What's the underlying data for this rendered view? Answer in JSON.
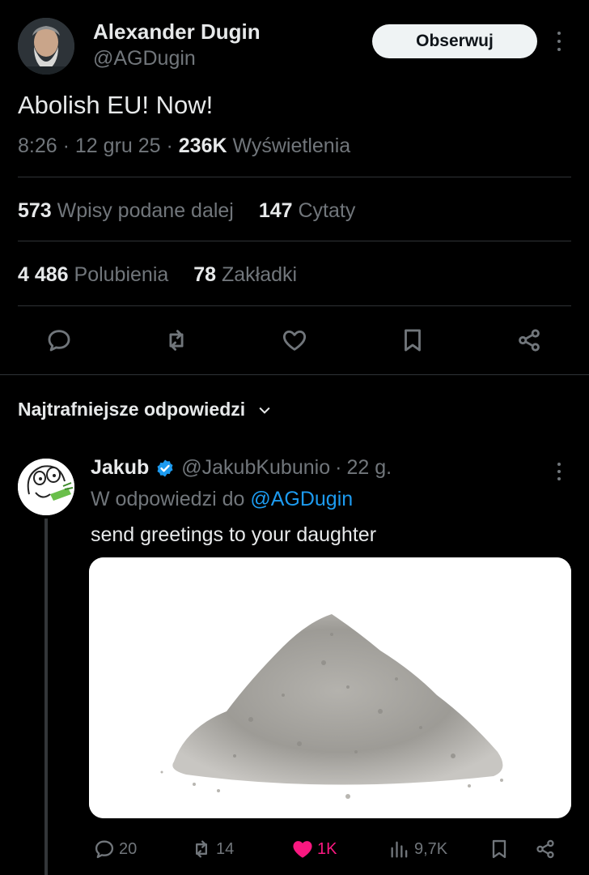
{
  "tweet": {
    "author_name": "Alexander Dugin",
    "author_handle": "@AGDugin",
    "follow_label": "Obserwuj",
    "text": "Abolish EU! Now!",
    "time": "8:26",
    "date": "12 gru 25",
    "views_count": "236K",
    "views_label": "Wyświetlenia",
    "separator": "·"
  },
  "stats": {
    "reposts_count": "573",
    "reposts_label": "Wpisy podane dalej",
    "quotes_count": "147",
    "quotes_label": "Cytaty",
    "likes_count": "4 486",
    "likes_label": "Polubienia",
    "bookmarks_count": "78",
    "bookmarks_label": "Zakładki"
  },
  "actions": [
    "reply-icon",
    "repost-icon",
    "like-icon",
    "bookmark-icon",
    "share-icon"
  ],
  "replies_section": {
    "sort_label": "Najtrafniejsze odpowiedzi"
  },
  "reply": {
    "name": "Jakub",
    "verified": true,
    "handle": "@JakubKubunio",
    "age": "22 g.",
    "reply_to_prefix": "W odpowiedzi do",
    "reply_to_handle": "@AGDugin",
    "text": "send greetings to your daughter",
    "media_description": "pile of grey ash on white background",
    "counts": {
      "replies": "20",
      "reposts": "14",
      "likes": "1K",
      "views": "9,7K"
    },
    "liked": true
  },
  "colors": {
    "background": "#000000",
    "text_primary": "#e7e9ea",
    "text_secondary": "#71767b",
    "divider": "#2f3336",
    "link": "#1d9bf0",
    "like": "#f91880",
    "follow_bg": "#eff3f4"
  }
}
